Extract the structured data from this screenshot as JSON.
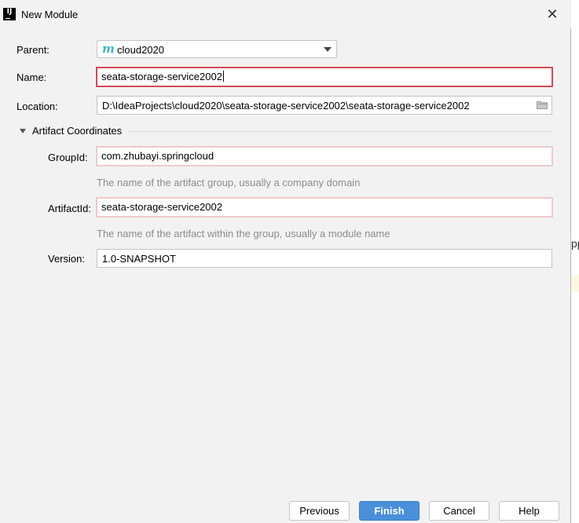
{
  "window": {
    "title": "New Module",
    "app_icon_text": "IJ",
    "close_glyph": "✕"
  },
  "form": {
    "parent_label": "Parent:",
    "parent_value": "cloud2020",
    "parent_icon": "maven-m-icon",
    "name_label": "Name:",
    "name_value": "seata-storage-service2002",
    "location_label": "Location:",
    "location_value": "D:\\IdeaProjects\\cloud2020\\seata-storage-service2002\\seata-storage-service2002",
    "section_title": "Artifact Coordinates",
    "groupid_label": "GroupId:",
    "groupid_value": "com.zhubayi.springcloud",
    "groupid_hint": "The name of the artifact group, usually a company domain",
    "artifactid_label": "ArtifactId:",
    "artifactid_value": "seata-storage-service2002",
    "artifactid_hint": "The name of the artifact within the group, usually a module name",
    "version_label": "Version:",
    "version_value": "1.0-SNAPSHOT"
  },
  "buttons": {
    "previous": "Previous",
    "finish": "Finish",
    "cancel": "Cancel",
    "help": "Help"
  },
  "background": {
    "fragment_text": "pp"
  },
  "colors": {
    "error_border": "#d34a55",
    "error_border_light": "#efc9c9",
    "primary_button": "#4a8fd9",
    "maven_icon": "#3fb6c8"
  }
}
